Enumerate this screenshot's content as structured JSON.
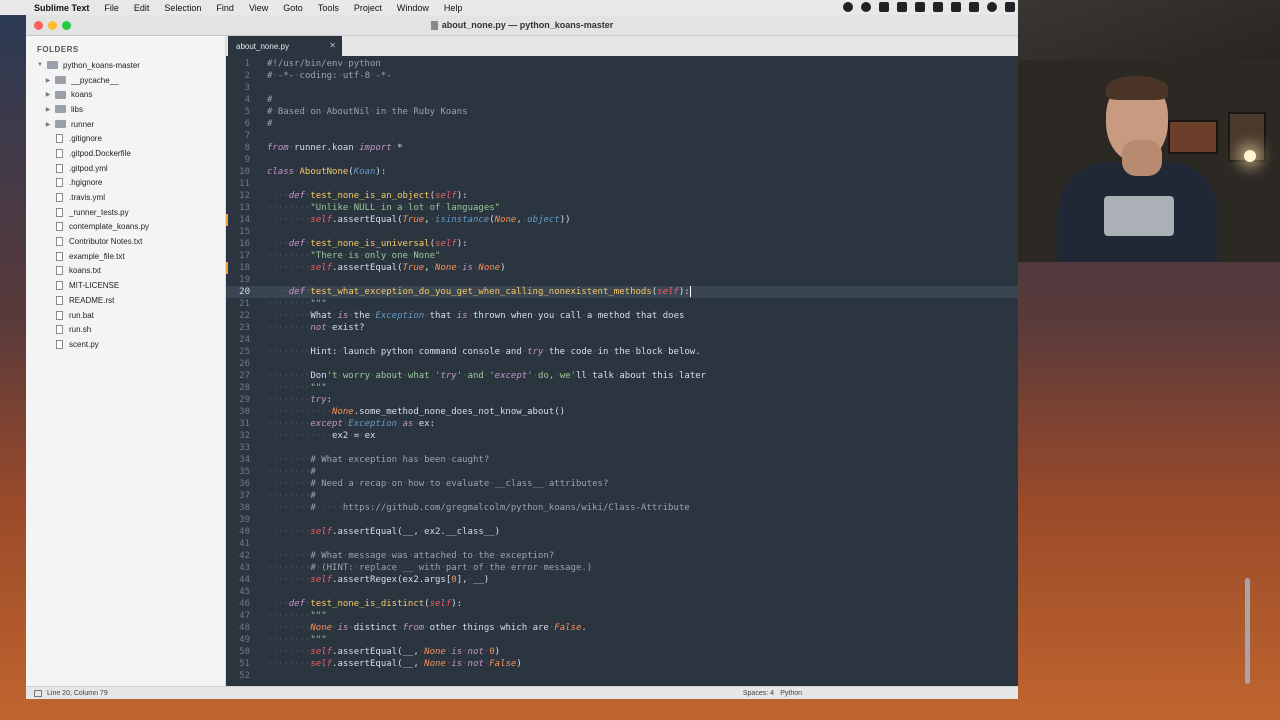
{
  "menubar": {
    "app": "Sublime Text",
    "items": [
      "File",
      "Edit",
      "Selection",
      "Find",
      "View",
      "Goto",
      "Tools",
      "Project",
      "Window",
      "Help"
    ]
  },
  "window": {
    "title": "about_none.py — python_koans-master"
  },
  "sidebar": {
    "heading": "FOLDERS",
    "root": "python_koans-master",
    "folders": [
      "__pycache__",
      "koans",
      "libs",
      "runner"
    ],
    "files": [
      ".gitignore",
      ".gitpod.Dockerfile",
      ".gitpod.yml",
      ".hgignore",
      ".travis.yml",
      "_runner_tests.py",
      "contemplate_koans.py",
      "Contributor Notes.txt",
      "example_file.txt",
      "koans.txt",
      "MIT-LICENSE",
      "README.rst",
      "run.bat",
      "run.sh",
      "scent.py"
    ]
  },
  "tabs": [
    {
      "label": "about_none.py",
      "active": true
    }
  ],
  "editor": {
    "current_line": 20,
    "line_numbers": [
      "1",
      "2",
      "3",
      "4",
      "5",
      "6",
      "7",
      "8",
      "9",
      "10",
      "11",
      "12",
      "13",
      "14",
      "15",
      "16",
      "17",
      "18",
      "19",
      "20",
      "21",
      "22",
      "23",
      "24",
      "25",
      "26",
      "27",
      "28",
      "29",
      "30",
      "31",
      "32",
      "33",
      "34",
      "35",
      "36",
      "37",
      "38",
      "39",
      "40",
      "41",
      "42",
      "43",
      "44",
      "45",
      "46",
      "47",
      "48",
      "49",
      "50",
      "51",
      "52"
    ],
    "lines": [
      "#!/usr/bin/env python",
      "# -*- coding: utf-8 -*-",
      "",
      "#",
      "# Based on AboutNil in the Ruby Koans",
      "#",
      "",
      "from runner.koan import *",
      "",
      "class AboutNone(Koan):",
      "",
      "    def test_none_is_an_object(self):",
      "        \"Unlike NULL in a lot of languages\"",
      "        self.assertEqual(True, isinstance(None, object))",
      "",
      "    def test_none_is_universal(self):",
      "        \"There is only one None\"",
      "        self.assertEqual(True, None is None)",
      "",
      "    def test_what_exception_do_you_get_when_calling_nonexistent_methods(self):",
      "        \"\"\"",
      "        What is the Exception that is thrown when you call a method that does",
      "        not exist?",
      "",
      "        Hint: launch python command console and try the code in the block below.",
      "",
      "        Don't worry about what 'try' and 'except' do, we'll talk about this later",
      "        \"\"\"",
      "        try:",
      "            None.some_method_none_does_not_know_about()",
      "        except Exception as ex:",
      "            ex2 = ex",
      "",
      "        # What exception has been caught?",
      "        #",
      "        # Need a recap on how to evaluate __class__ attributes?",
      "        #",
      "        #     https://github.com/gregmalcolm/python_koans/wiki/Class-Attribute",
      "",
      "        self.assertEqual(__, ex2.__class__)",
      "",
      "        # What message was attached to the exception?",
      "        # (HINT: replace __ with part of the error message.)",
      "        self.assertRegex(ex2.args[0], __)",
      "",
      "    def test_none_is_distinct(self):",
      "        \"\"\"",
      "        None is distinct from other things which are False.",
      "        \"\"\"",
      "        self.assertEqual(__, None is not 0)",
      "        self.assertEqual(__, None is not False)",
      ""
    ]
  },
  "statusbar": {
    "position": "Line 20, Column 79",
    "spaces": "Spaces: 4",
    "syntax": "Python"
  },
  "colors": {
    "editor_bg": "#2b3540",
    "keyword": "#c594c5",
    "function": "#fac863",
    "string": "#99c794",
    "comment": "#9aa3ad",
    "self": "#ec5f67",
    "constant": "#f99157"
  }
}
